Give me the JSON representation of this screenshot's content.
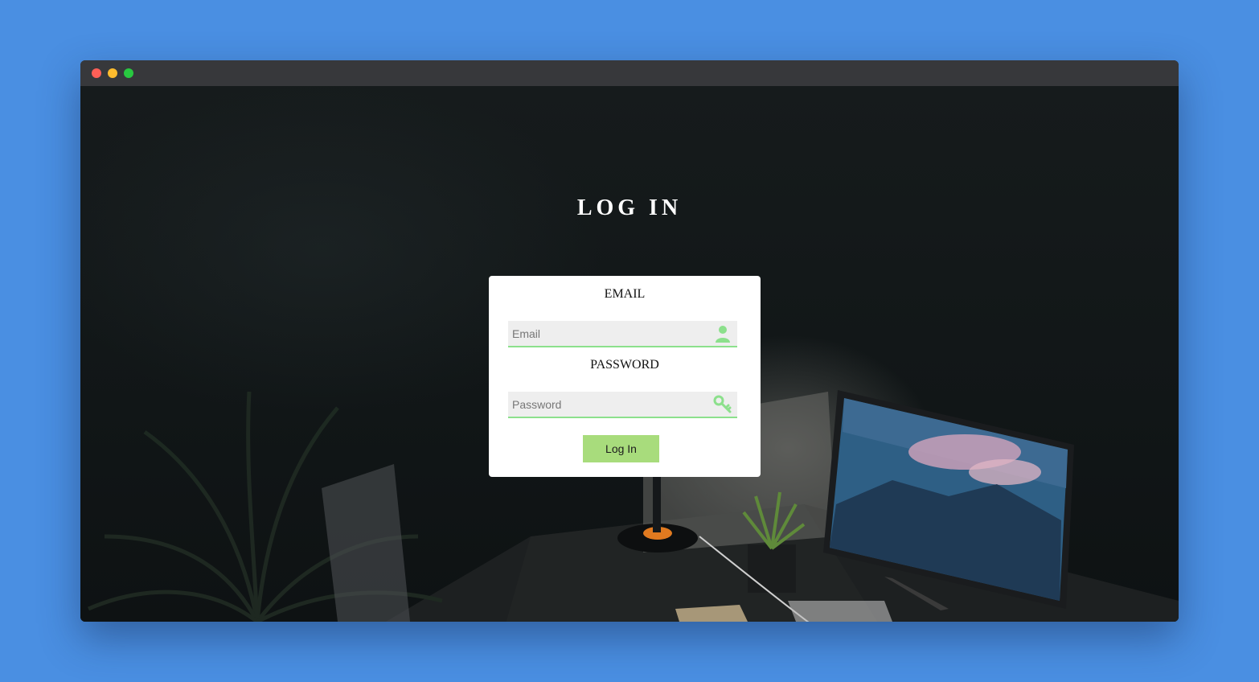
{
  "page": {
    "heading": "LOG IN"
  },
  "form": {
    "email_label": "EMAIL",
    "email_placeholder": "Email",
    "email_value": "",
    "password_label": "PASSWORD",
    "password_placeholder": "Password",
    "password_value": "",
    "submit_label": "Log In"
  },
  "icons": {
    "email_icon": "user-icon",
    "password_icon": "key-icon"
  },
  "colors": {
    "page_background": "#4a8fe2",
    "accent_green": "#8ce08c",
    "button_green": "#a8dc7c",
    "titlebar": "#37383b"
  }
}
